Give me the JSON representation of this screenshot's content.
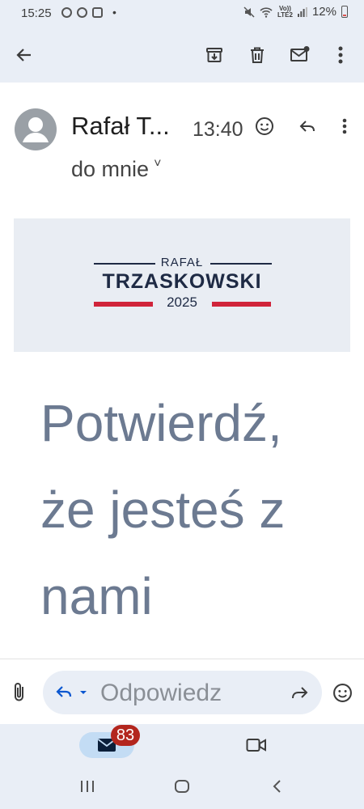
{
  "status_bar": {
    "time": "15:25",
    "left_icons": [
      "sync-icon",
      "pinterest-icon",
      "instagram-icon"
    ],
    "dot": "•",
    "network": "Vo))\nLTE2",
    "battery": "12%"
  },
  "toolbar": {
    "icons": [
      "back-arrow-icon",
      "archive-icon",
      "delete-icon",
      "mark-unread-icon",
      "more-vert-icon"
    ]
  },
  "message": {
    "sender": "Rafał T...",
    "time": "13:40",
    "recipient": "do mnie",
    "recipient_chevron": "˅"
  },
  "banner": {
    "top": "RAFAŁ",
    "main": "TRZASKOWSKI",
    "year": "2025",
    "accent_color": "#d0243a",
    "text_color": "#1e2a44"
  },
  "body": {
    "headline_lines": [
      "Potwierdź,",
      "że jesteś z",
      "nami"
    ],
    "headline_color": "#6c7a91"
  },
  "reply_bar": {
    "placeholder": "Odpowiedz"
  },
  "bottom_nav": {
    "mail_badge": "83",
    "badge_color": "#b3261e"
  }
}
